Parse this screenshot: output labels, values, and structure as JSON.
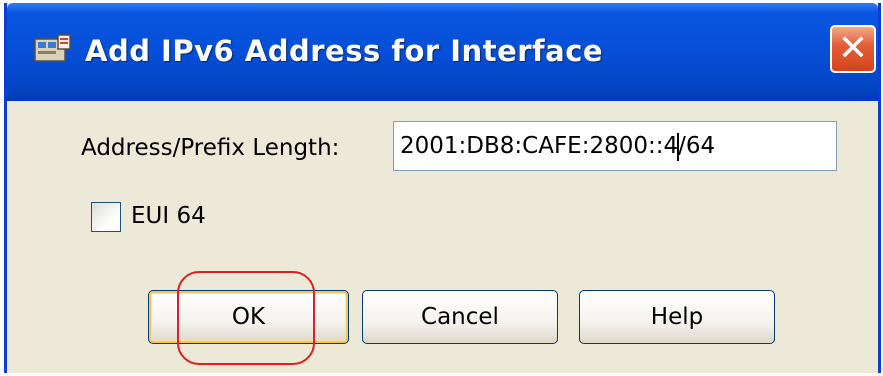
{
  "dialog": {
    "title": "Add IPv6 Address for Interface",
    "close_glyph": "✕",
    "icon": "network-interface-icon"
  },
  "form": {
    "address_label": "Address/Prefix Length:",
    "address_value_before_caret": "2001:DB8:CAFE:2800::4",
    "address_value_after_caret": "/64",
    "eui64_label": "EUI 64",
    "eui64_checked": false
  },
  "buttons": {
    "ok": "OK",
    "cancel": "Cancel",
    "help": "Help"
  },
  "colors": {
    "titlebar": "#0650d8",
    "highlight_annotation": "#e02020"
  }
}
